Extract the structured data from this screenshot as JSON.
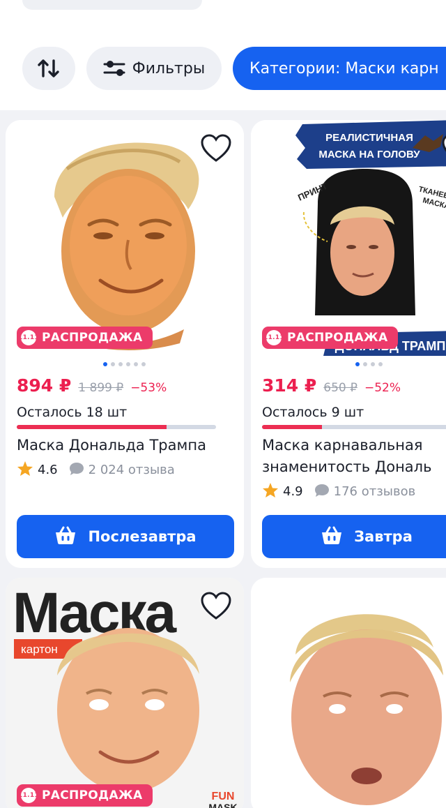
{
  "toolbar": {
    "sort_icon": "sort-arrows-icon",
    "filters_label": "Фильтры",
    "filters_icon": "sliders-icon",
    "category_label": "Категории: Маски карн"
  },
  "colors": {
    "accent": "#1662f0",
    "sale": "#ec3b6a",
    "price": "#ec1f4f",
    "star": "#f5a623"
  },
  "products": [
    {
      "image_text": "",
      "badge": "РАСПРОДАЖА",
      "badge_icon": "11.11",
      "photos_total": 6,
      "photo_active": 1,
      "price": "894 ₽",
      "old_price": "1 899 ₽",
      "discount": "−53%",
      "stock_text": "Осталось 18 шт",
      "stock_fill_fraction": 0.75,
      "title_lines": [
        "Маска Дональда Трампа"
      ],
      "rating": "4.6",
      "reviews": "2 024 отзыва",
      "button_label": "Послезавтра",
      "button_icon": "basket-icon"
    },
    {
      "image_banner_lines": [
        "РЕАЛИСТИЧНАЯ",
        "МАСКА НА ГОЛОВУ"
      ],
      "image_label_print": "ПРИНТ",
      "image_label_fabric_lines": [
        "ТКАНЕВАЯ",
        "МАСКА"
      ],
      "image_bottom_text": "ДОНАЛЬД ТРАМП",
      "badge": "РАСПРОДАЖА",
      "badge_icon": "11.11",
      "photos_total": 4,
      "photo_active": 1,
      "price": "314 ₽",
      "old_price": "650 ₽",
      "discount": "−52%",
      "stock_text": "Осталось 9 шт",
      "stock_fill_fraction": 0.3,
      "title_lines": [
        "Маска карнавальная",
        "знаменитость Дональ"
      ],
      "rating": "4.9",
      "reviews": "176 отзывов",
      "button_label": "Завтра",
      "button_icon": "basket-icon"
    },
    {
      "image_headline": "Маска",
      "image_tag": "картон",
      "badge": "РАСПРОДАЖА",
      "badge_icon": "11.11",
      "brand_lines": [
        "FUN",
        "MASK"
      ]
    },
    {
      "image_text": ""
    }
  ]
}
